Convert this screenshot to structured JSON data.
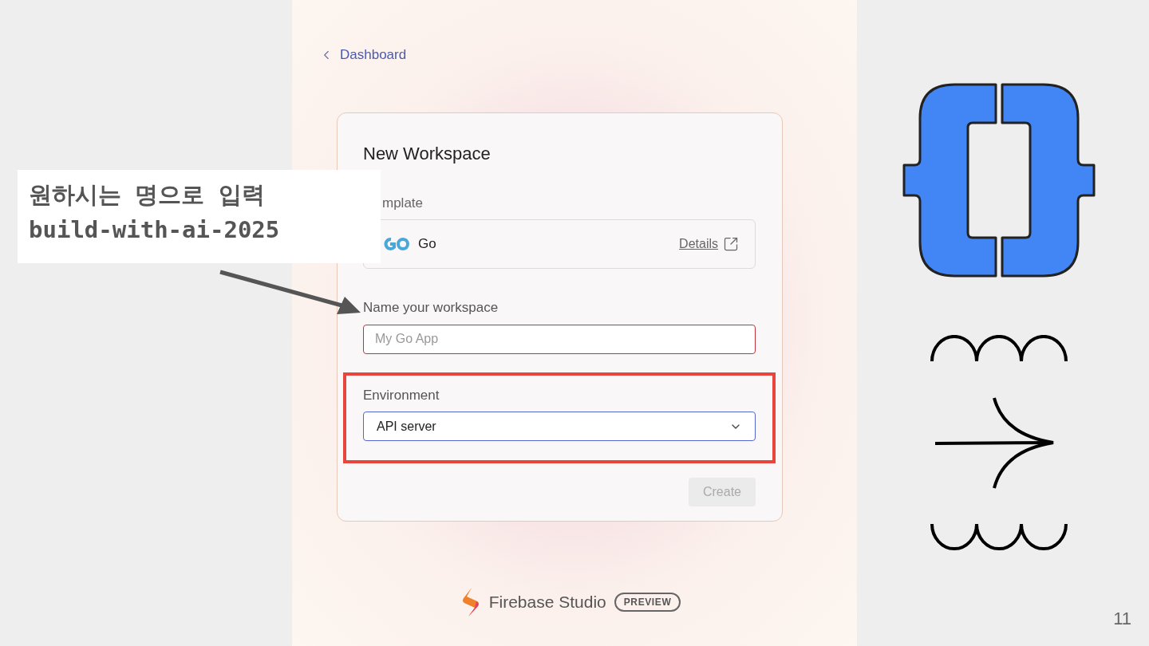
{
  "back_link": {
    "label": "Dashboard"
  },
  "dialog": {
    "title": "New Workspace",
    "template": {
      "label": "mplate",
      "name": "Go",
      "details": "Details"
    },
    "name_field": {
      "label": "Name your workspace",
      "placeholder": "My Go App"
    },
    "environment": {
      "label": "Environment",
      "value": "API server"
    },
    "create_button": {
      "label": "Create",
      "disabled": true
    }
  },
  "footer": {
    "brand": "Firebase Studio",
    "badge": "PREVIEW"
  },
  "callout": {
    "lines": [
      "원하시는 명으로 입력",
      "build-with-ai-2025"
    ]
  },
  "page_number": "11"
}
